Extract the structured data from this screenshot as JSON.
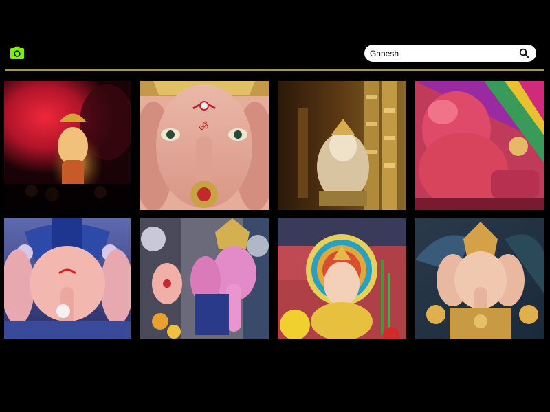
{
  "header": {
    "logo_icon": "camera-icon",
    "logo_color": "#7cf000",
    "accent_color": "#b1962b"
  },
  "search": {
    "value": "Ganesh",
    "icon": "search-icon"
  },
  "gallery": {
    "tiles": [
      {
        "subject": "ganesh-idol-red-smoke"
      },
      {
        "subject": "ganesh-face-closeup-pink"
      },
      {
        "subject": "ganesh-idol-golden-pillars"
      },
      {
        "subject": "ganesh-idol-pink-colorful-tent"
      },
      {
        "subject": "ganesh-idol-blue-crown"
      },
      {
        "subject": "ganesh-idol-pink-silver-ornaments"
      },
      {
        "subject": "ganesh-idol-peacock-halo-flowers"
      },
      {
        "subject": "ganesh-idol-gold-ornaments-dark-background"
      }
    ]
  }
}
